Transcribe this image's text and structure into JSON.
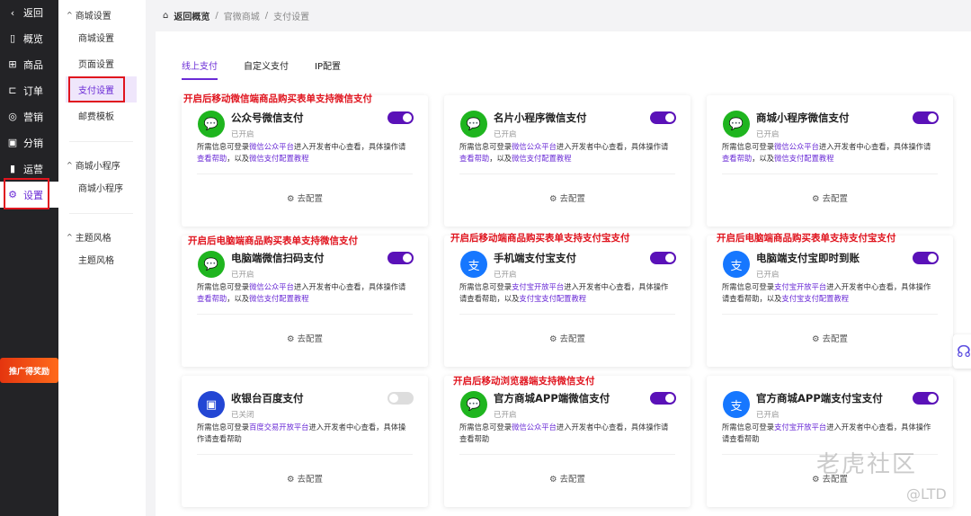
{
  "sidebar": {
    "items": [
      {
        "label": "返回",
        "icon": "chevron-left-icon",
        "glyph": "‹"
      },
      {
        "label": "概览",
        "icon": "book-icon",
        "glyph": "▯"
      },
      {
        "label": "商品",
        "icon": "gift-icon",
        "glyph": "⊞"
      },
      {
        "label": "订单",
        "icon": "folder-icon",
        "glyph": "⊏"
      },
      {
        "label": "营销",
        "icon": "target-icon",
        "glyph": "◎"
      },
      {
        "label": "分销",
        "icon": "monitor-icon",
        "glyph": "▣"
      },
      {
        "label": "运营",
        "icon": "bar-chart-icon",
        "glyph": "▮"
      },
      {
        "label": "设置",
        "icon": "gear-icon",
        "glyph": "⚙"
      }
    ],
    "active": 7,
    "promo": "推广得奖励"
  },
  "subnav": {
    "groups": [
      {
        "title": "商城设置",
        "items": [
          "商城设置",
          "页面设置",
          "支付设置",
          "邮费模板"
        ]
      },
      {
        "title": "商城小程序",
        "items": [
          "商城小程序"
        ]
      },
      {
        "title": "主题风格",
        "items": [
          "主题风格"
        ]
      }
    ],
    "active": "支付设置"
  },
  "breadcrumb": {
    "home": "返回概览",
    "items": [
      "官微商城",
      "支付设置"
    ]
  },
  "tabs": [
    "线上支付",
    "自定义支付",
    "IP配置"
  ],
  "active_tab": 0,
  "colors": {
    "accent": "#5a11b8",
    "annotation": "#e0141e",
    "wechat": "#1fb51f",
    "alipay": "#1677ff",
    "baidu": "#2346d4"
  },
  "config_label": "去配置",
  "cards": [
    {
      "title": "公众号微信支付",
      "status": "已开启",
      "on": true,
      "icon": "wechat-icon",
      "kind": "wechat",
      "desc": [
        [
          "所需信息可登录",
          0
        ],
        [
          "微信公众平台",
          1
        ],
        [
          "进入开发者中心查看，具体操作请",
          0
        ],
        [
          "查看帮助",
          1
        ],
        [
          "，以及",
          0
        ],
        [
          "微信支付配置教程",
          1
        ]
      ]
    },
    {
      "title": "名片小程序微信支付",
      "status": "已开启",
      "on": true,
      "icon": "card-mini-program-icon",
      "kind": "wechat",
      "desc": [
        [
          "所需信息可登录",
          0
        ],
        [
          "微信公众平台",
          1
        ],
        [
          "进入开发者中心查看，具体操作请",
          0
        ],
        [
          "查看帮助",
          1
        ],
        [
          "，以及",
          0
        ],
        [
          "微信支付配置教程",
          1
        ]
      ]
    },
    {
      "title": "商城小程序微信支付",
      "status": "已开启",
      "on": true,
      "icon": "mall-mini-program-icon",
      "kind": "wechat",
      "desc": [
        [
          "所需信息可登录",
          0
        ],
        [
          "微信公众平台",
          1
        ],
        [
          "进入开发者中心查看，具体操作请",
          0
        ],
        [
          "查看帮助",
          1
        ],
        [
          "，以及",
          0
        ],
        [
          "微信支付配置教程",
          1
        ]
      ]
    },
    {
      "title": "电脑端微信扫码支付",
      "status": "已开启",
      "on": true,
      "icon": "desktop-wechat-icon",
      "kind": "wechat",
      "desc": [
        [
          "所需信息可登录",
          0
        ],
        [
          "微信公众平台",
          1
        ],
        [
          "进入开发者中心查看，具体操作请",
          0
        ],
        [
          "查看帮助",
          1
        ],
        [
          "，以及",
          0
        ],
        [
          "微信支付配置教程",
          1
        ]
      ]
    },
    {
      "title": "手机端支付宝支付",
      "status": "已开启",
      "on": true,
      "icon": "mobile-alipay-icon",
      "kind": "alipay",
      "desc": [
        [
          "所需信息可登录",
          0
        ],
        [
          "支付宝开放平台",
          1
        ],
        [
          "进入开发者中心查看，具体操作请查看帮助，以及",
          0
        ],
        [
          "支付宝支付配置教程",
          1
        ]
      ]
    },
    {
      "title": "电脑端支付宝即时到账",
      "status": "已开启",
      "on": true,
      "icon": "desktop-alipay-icon",
      "kind": "alipay",
      "desc": [
        [
          "所需信息可登录",
          0
        ],
        [
          "支付宝开放平台",
          1
        ],
        [
          "进入开发者中心查看，具体操作请查看帮助，以及",
          0
        ],
        [
          "支付宝支付配置教程",
          1
        ]
      ]
    },
    {
      "title": "收银台百度支付",
      "status": "已关闭",
      "on": false,
      "icon": "baidu-pay-icon",
      "kind": "baidu",
      "desc": [
        [
          "所需信息可登录",
          0
        ],
        [
          "百度交易开放平台",
          1
        ],
        [
          "进入开发者中心查看，具体操作请查看帮助",
          0
        ]
      ]
    },
    {
      "title": "官方商城APP端微信支付",
      "status": "已开启",
      "on": true,
      "icon": "app-wechat-icon",
      "kind": "wechat",
      "desc": [
        [
          "所需信息可登录",
          0
        ],
        [
          "微信公众平台",
          1
        ],
        [
          "进入开发者中心查看，具体操作请查看帮助",
          0
        ]
      ]
    },
    {
      "title": "官方商城APP端支付宝支付",
      "status": "已开启",
      "on": true,
      "icon": "app-alipay-icon",
      "kind": "alipay",
      "desc": [
        [
          "所需信息可登录",
          0
        ],
        [
          "支付宝开放平台",
          1
        ],
        [
          "进入开发者中心查看，具体操作请查看帮助",
          0
        ]
      ]
    }
  ],
  "annotations": [
    {
      "card": 0,
      "text": "开启后移动微信端商品购买表单支持微信支付"
    },
    {
      "card": 3,
      "text": "开启后电脑端商品购买表单支持微信支付"
    },
    {
      "card": 4,
      "text": "开启后移动端商品购买表单支持支付宝支付"
    },
    {
      "card": 5,
      "text": "开启后电脑端商品购买表单支持支付宝支付"
    },
    {
      "card": 7,
      "text": "开启后移动浏览器端支持微信支付"
    }
  ],
  "watermark": {
    "name": "老虎社区",
    "handle": "@LTD"
  }
}
